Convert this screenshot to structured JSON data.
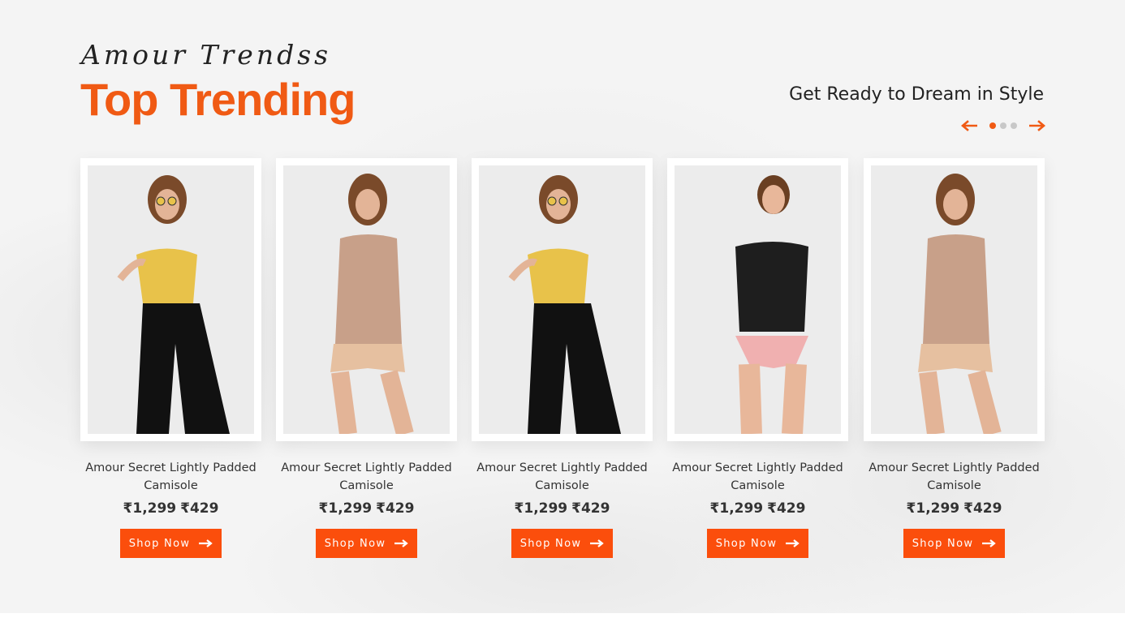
{
  "header": {
    "brand": "Amour Trendss",
    "title": "Top Trending",
    "tagline": "Get Ready to Dream in Style"
  },
  "slider": {
    "prev_icon": "arrow-left-icon",
    "next_icon": "arrow-right-icon",
    "dots": 3,
    "active_dot": 0
  },
  "products": [
    {
      "name": "Amour Secret Lightly Padded Camisole",
      "old_price": "₹1,299",
      "price": "₹429",
      "cta": "Shop Now",
      "top_color": "#e8c24a",
      "bottom": "black jeans"
    },
    {
      "name": "Amour Secret Lightly Padded Camisole",
      "old_price": "₹1,299",
      "price": "₹429",
      "cta": "Shop Now",
      "top_color": "#c8a089",
      "bottom": "nude shorts"
    },
    {
      "name": "Amour Secret Lightly Padded Camisole",
      "old_price": "₹1,299",
      "price": "₹429",
      "cta": "Shop Now",
      "top_color": "#e8c24a",
      "bottom": "black jeans"
    },
    {
      "name": "Amour Secret Lightly Padded Camisole",
      "old_price": "₹1,299",
      "price": "₹429",
      "cta": "Shop Now",
      "top_color": "#1e1e1e",
      "bottom": "pink brief"
    },
    {
      "name": "Amour Secret Lightly Padded Camisole",
      "old_price": "₹1,299",
      "price": "₹429",
      "cta": "Shop Now",
      "top_color": "#c8a089",
      "bottom": "nude shorts"
    }
  ],
  "colors": {
    "accent": "#f05a14",
    "button": "#fb4e0c",
    "text": "#333333"
  }
}
